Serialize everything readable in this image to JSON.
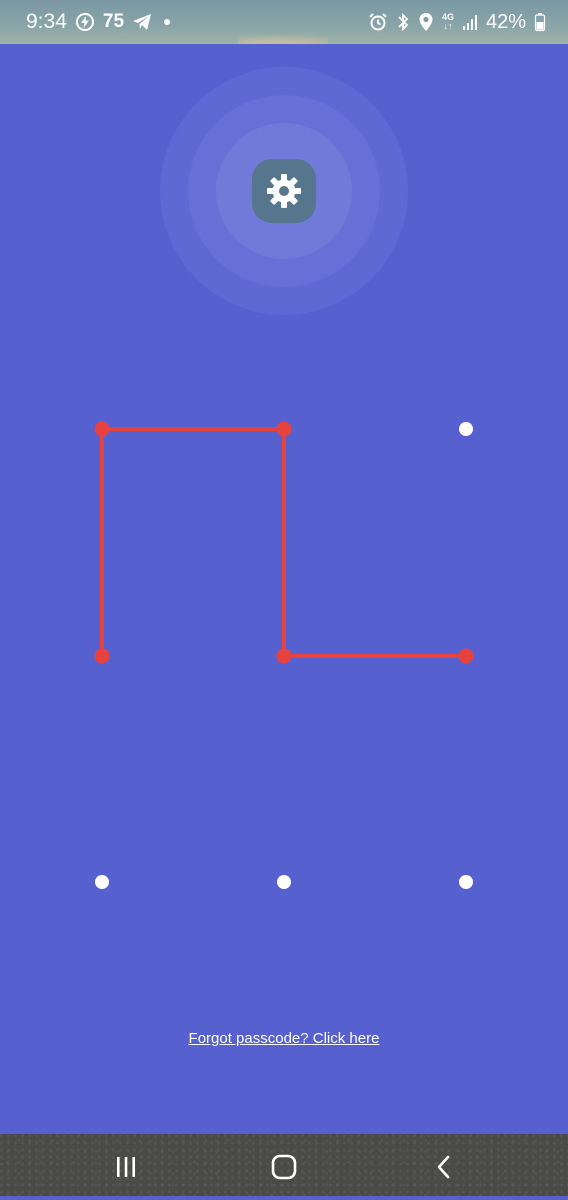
{
  "status_bar": {
    "time": "9:34",
    "notification_count": "75",
    "network": "4G",
    "battery": "42%"
  },
  "icons": {
    "settings": "gear-icon",
    "pattern_dot": "pattern-dot",
    "recent_apps": "recent-apps-icon",
    "home": "home-icon",
    "back": "back-icon"
  },
  "colors": {
    "background": "#5760CF",
    "pattern_line": "#E8423F",
    "dot": "#FFFFFF",
    "gear_tile": "#55768C"
  },
  "pattern": {
    "selected_sequence": [
      4,
      1,
      2,
      5,
      6
    ]
  },
  "footer": {
    "forgot_link": "Forgot passcode? Click here"
  }
}
